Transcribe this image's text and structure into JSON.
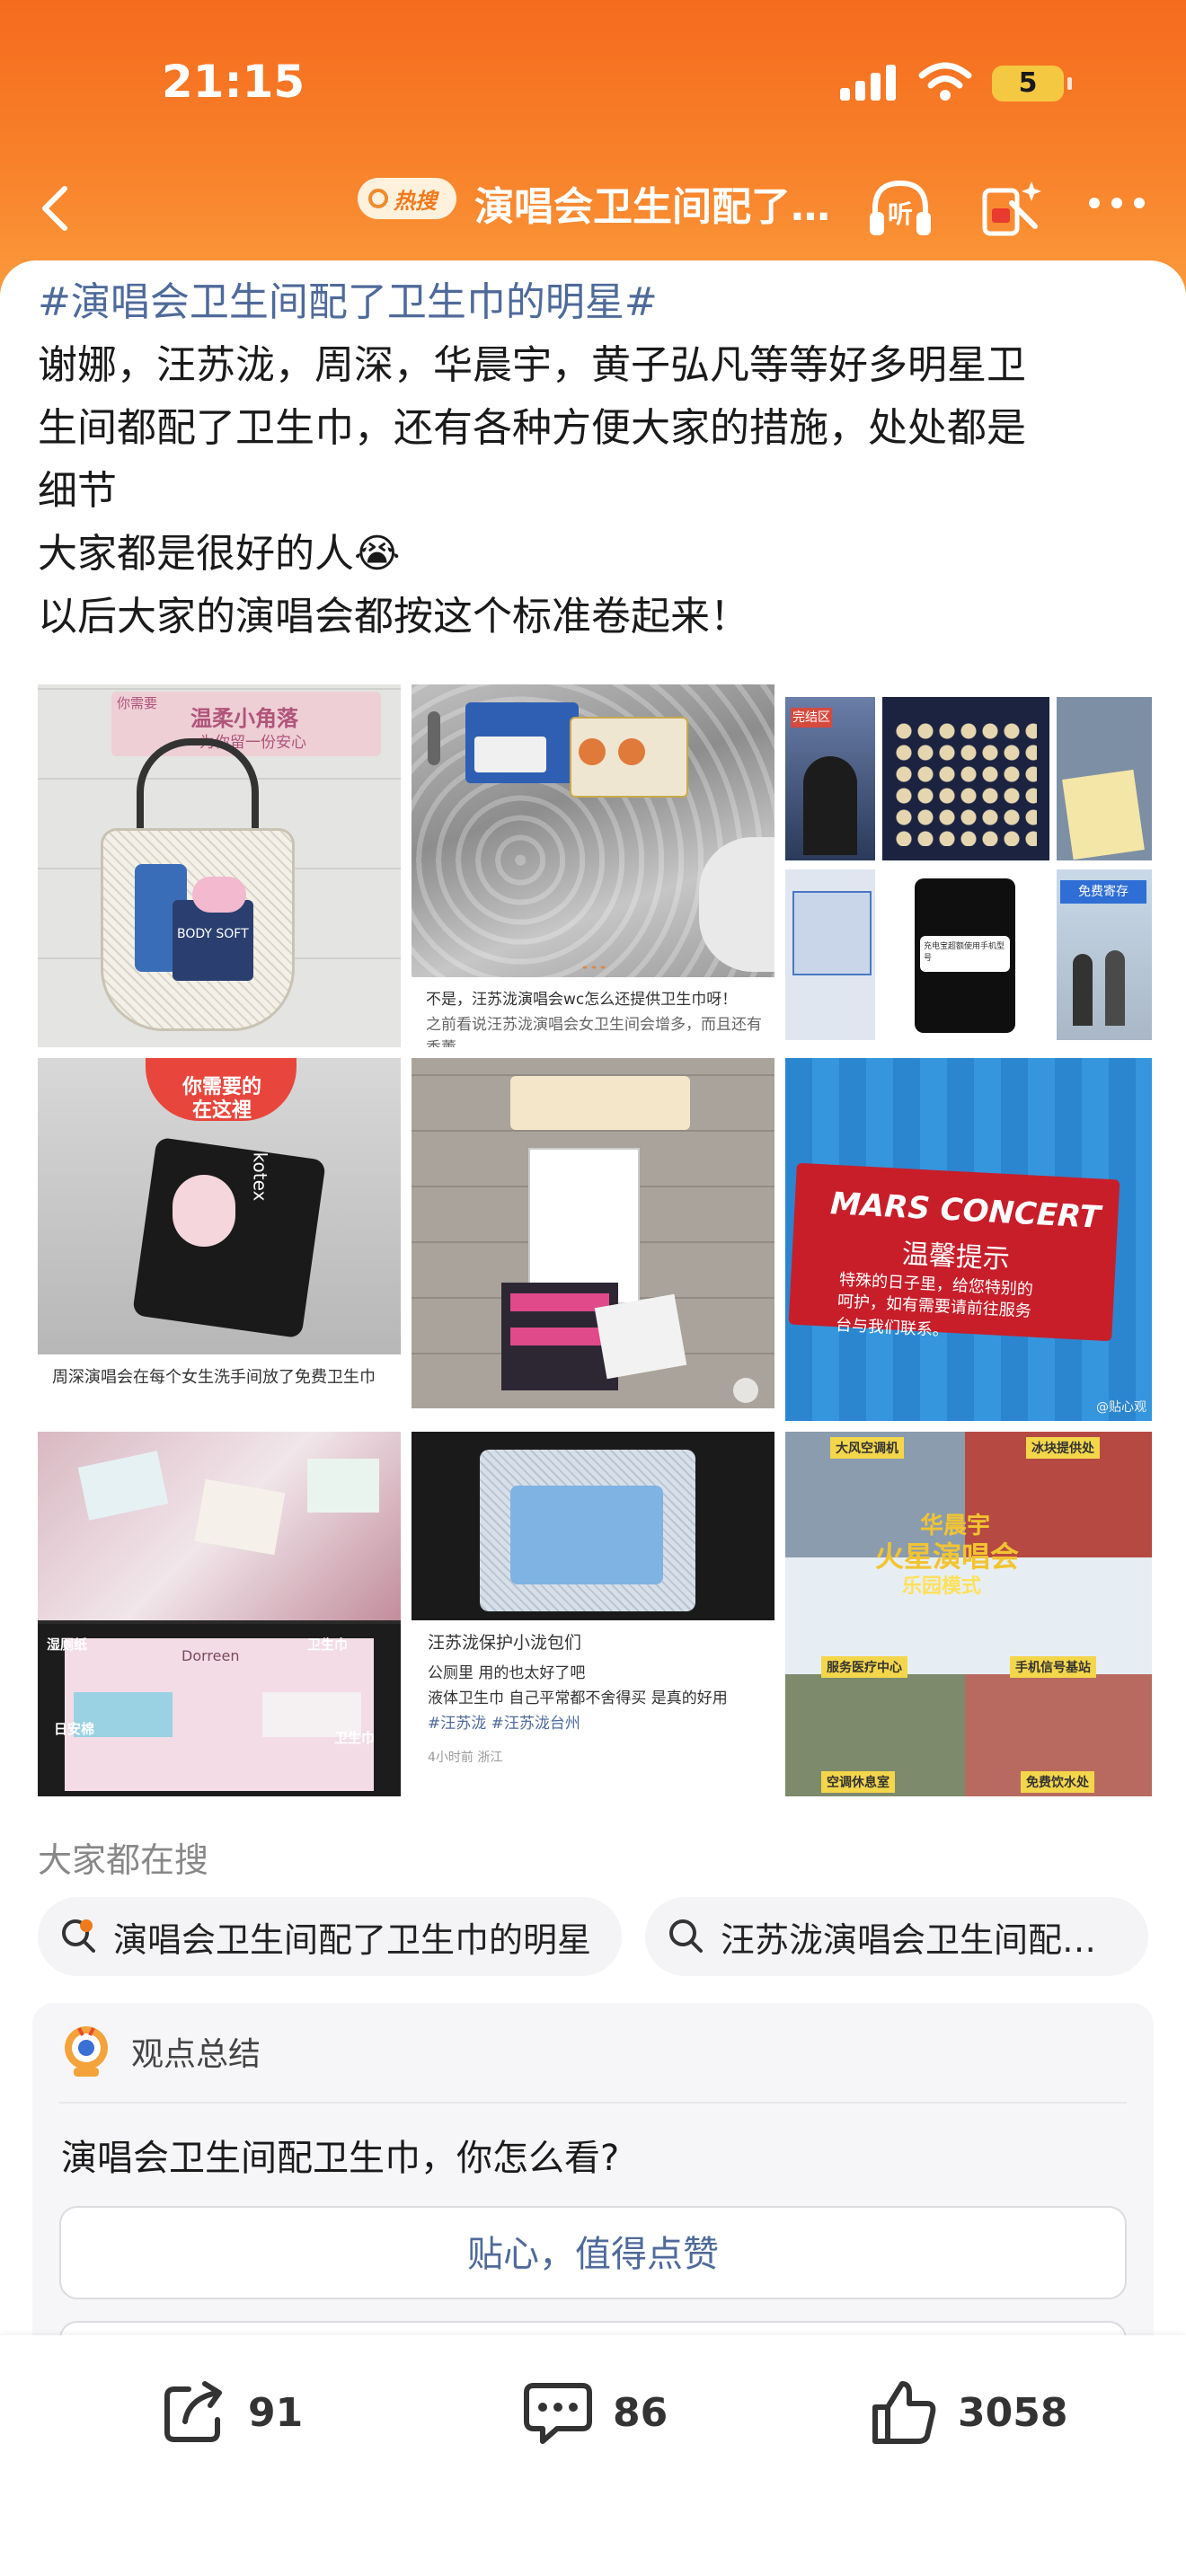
{
  "status": {
    "time": "21:15",
    "battery": "5"
  },
  "nav": {
    "badge": "热搜",
    "title": "演唱会卫生间配了…",
    "listen": "听"
  },
  "post": {
    "hashtag": "#演唱会卫生间配了卫生巾的明星#",
    "line1": "谢娜，汪苏泷，周深，华晨宇，黄子弘凡等等好多明星卫",
    "line2": "生间都配了卫生巾，还有各种方便大家的措施，处处都是",
    "line3": "细节",
    "line4": "大家都是很好的人😭",
    "line5": "以后大家的演唱会都按这个标准卷起来！"
  },
  "photos": {
    "p1_sign_a": "你需要",
    "p1_sign_b": "温柔小角落",
    "p1_sign_c": "为你留一份安心",
    "p1_pack": "BODY SOFT",
    "p2_cap1": "不是，汪苏泷演唱会wc怎么还提供卫生巾呀！",
    "p2_cap2": "之前看说汪苏泷演唱会女卫生间会增多，而且还有香薰、",
    "p3_tag": "完结区",
    "p3_phone": "充电宝超额使用手机型号",
    "p3_blue": "免费寄存",
    "p4_sign_a": "你需要的",
    "p4_sign_b": "在这裡",
    "p4_pack": "kotex",
    "p4_cap": "周深演唱会在每个女生洗手间放了免费卫生巾",
    "p6_title": "MARS CONCERT",
    "p6_head": "温馨提示",
    "p6_body1": "特殊的日子里，给您特别的",
    "p6_body2": "呵护，如有需要请前往服务",
    "p6_body3": "台与我们联系。",
    "p6_wm": "@贴心观",
    "p7_brand": "Dorreen",
    "p7_l1": "湿厕纸",
    "p7_l2": "日安棉",
    "p7_l3": "卫生巾",
    "p7_l4": "卫生巾",
    "p8_cap1": "汪苏泷保护小泷包们",
    "p8_cap2": "公厕里 用的也太好了吧",
    "p8_cap3": "液体卫生巾 自己平常都不舍得买 是真的好用",
    "p8_tags": "#汪苏泷  #汪苏泷台州",
    "p8_meta": "4小时前 浙江",
    "p9_l1": "大风空调机",
    "p9_l2": "冰块提供处",
    "p9_title1": "华晨宇",
    "p9_title2": "火星演唱会",
    "p9_title3": "乐园模式",
    "p9_l3": "服务医疗中心",
    "p9_l4": "手机信号基站",
    "p9_l5": "空调休息室",
    "p9_l6": "免费饮水处"
  },
  "search": {
    "title": "大家都在搜",
    "chip1": "演唱会卫生间配了卫生巾的明星",
    "chip2": "汪苏泷演唱会卫生间配…"
  },
  "summary": {
    "title": "观点总结",
    "question": "演唱会卫生间配卫生巾，你怎么看?",
    "option1": "贴心，值得点赞"
  },
  "actions": {
    "share": "91",
    "comment": "86",
    "like": "3058"
  },
  "colors": {
    "nav_orange": "#f56b1e",
    "hashtag": "#4f6a9a",
    "hot": "#f07a1c"
  }
}
